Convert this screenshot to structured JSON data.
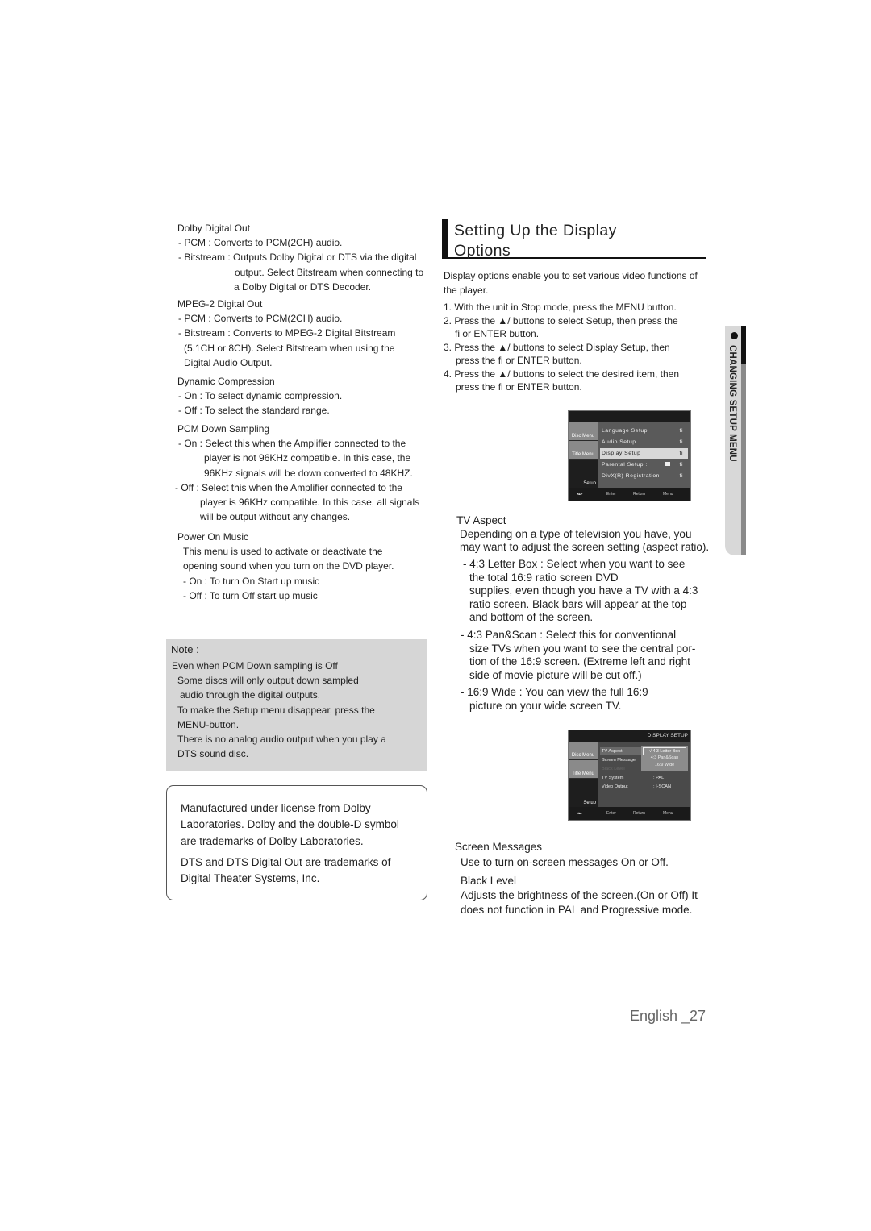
{
  "left_column": {
    "dolby_digital_out": {
      "title": "Dolby Digital Out",
      "lines": [
        "- PCM : Converts to PCM(2CH) audio.",
        "- Bitstream : Outputs Dolby Digital or DTS via the digital",
        "output. Select Bitstream when connecting to",
        "a Dolby Digital or DTS Decoder."
      ]
    },
    "mpeg2_digital_out": {
      "title": "MPEG-2 Digital Out",
      "lines": [
        "- PCM : Converts to PCM(2CH) audio.",
        "- Bitstream : Converts to MPEG-2 Digital Bitstream",
        "(5.1CH or 8CH). Select Bitstream when using the",
        "Digital Audio Output."
      ]
    },
    "dynamic_compression": {
      "title": "Dynamic Compression",
      "lines": [
        "- On : To select dynamic compression.",
        "- Off : To select the standard range."
      ]
    },
    "pcm_down_sampling": {
      "title": "PCM Down Sampling",
      "lines": [
        "- On : Select this when the Amplifier connected to the",
        "player is not 96KHz compatible. In this case, the",
        "96KHz  signals will be down converted to 48KHZ.",
        "- Off : Select this when the Amplifier connected to the",
        "player is 96KHz compatible. In this case, all signals",
        "will be output without any changes."
      ]
    },
    "power_on_music": {
      "title": "Power On Music",
      "lines": [
        "This menu is used to activate or deactivate the",
        "opening sound when you turn on the DVD player.",
        "- On : To turn On Start up music",
        "- Off : To turn Off start up music"
      ]
    }
  },
  "note": {
    "title": "Note :",
    "lines": [
      "Even when PCM Down sampling is Off",
      "Some discs will only output down sampled",
      "audio through the digital outputs.",
      "To make the Setup menu disappear, press the",
      "MENU-button.",
      "There is no analog audio output when you play a",
      "DTS sound disc."
    ]
  },
  "trademark": {
    "lines": [
      "Manufactured under license from Dolby",
      "Laboratories.  Dolby  and the double-D symbol",
      "are trademarks of Dolby Laboratories.",
      "DTS  and  DTS Digital Out  are trademarks of",
      "Digital Theater Systems, Inc."
    ]
  },
  "heading": {
    "line1": "Setting Up the Display",
    "line2": "Options"
  },
  "intro": {
    "lines": [
      "Display options enable you to set various video functions of",
      "the player."
    ]
  },
  "steps": [
    [
      "1. With the unit in Stop mode, press the MENU button."
    ],
    [
      "2. Press the ▲/  buttons to select Setup, then press the",
      "fi or ENTER button."
    ],
    [
      "3. Press the ▲/  buttons to select Display Setup, then",
      "press the fi or ENTER button."
    ],
    [
      "4. Press the ▲/  buttons to select the desired item, then",
      "press the fi or ENTER button."
    ]
  ],
  "osd_setup": {
    "side": [
      "Disc Menu",
      "Title Menu",
      "Setup"
    ],
    "items": [
      {
        "label": "Language Setup",
        "arrow": "fi"
      },
      {
        "label": "Audio Setup",
        "arrow": "fi"
      },
      {
        "label": "Display Setup",
        "arrow": "fi"
      },
      {
        "label": "Parental Setup :",
        "arrow": "fi"
      },
      {
        "label": "DivX(R) Registration",
        "arrow": "fi"
      }
    ],
    "selected_index": 2,
    "footer": [
      "Enter",
      "Return",
      "Menu"
    ]
  },
  "tv_aspect": {
    "title": "TV Aspect",
    "desc": [
      "Depending on a type of television you have, you",
      "may want to adjust the screen setting (aspect ratio)."
    ],
    "options": [
      [
        "- 4:3 Letter Box : Select when you want to see",
        "the total 16:9 ratio screen DVD",
        "supplies, even though you have a TV with a 4:3",
        "ratio screen. Black bars will appear at the top",
        "and bottom of the screen."
      ],
      [
        "- 4:3 Pan&Scan : Select this for conventional",
        "size TVs when you want to see the central por-",
        "tion of the 16:9 screen. (Extreme left and right",
        "side of movie picture will be cut off.)"
      ],
      [
        "- 16:9 Wide : You can view the full 16:9",
        "picture on your wide screen TV."
      ]
    ]
  },
  "osd_display": {
    "header": "DISPLAY SETUP",
    "side": [
      "Disc Menu",
      "Title Menu",
      "Setup"
    ],
    "items": [
      {
        "label": "TV Aspect",
        "value": ""
      },
      {
        "label": "Screen Message",
        "value": ""
      },
      {
        "label": "Black Level",
        "value": ""
      },
      {
        "label": "TV System",
        "value": ": PAL"
      },
      {
        "label": "Video Output",
        "value": ": I-SCAN"
      }
    ],
    "popup": [
      "√ 4:3 Letter Box",
      "4:3 Pan&Scan",
      "16:9 Wide"
    ],
    "footer": [
      "Enter",
      "Return",
      "Menu"
    ]
  },
  "screen_messages": {
    "title": "Screen Messages",
    "desc": "Use to turn on-screen messages On or Off."
  },
  "black_level": {
    "title": "Black Level",
    "desc": [
      "Adjusts the brightness of the screen.(On or Off) It",
      "does not function in PAL and Progressive mode."
    ]
  },
  "side_tab": "CHANGING SETUP MENU",
  "page_number": "English _27"
}
